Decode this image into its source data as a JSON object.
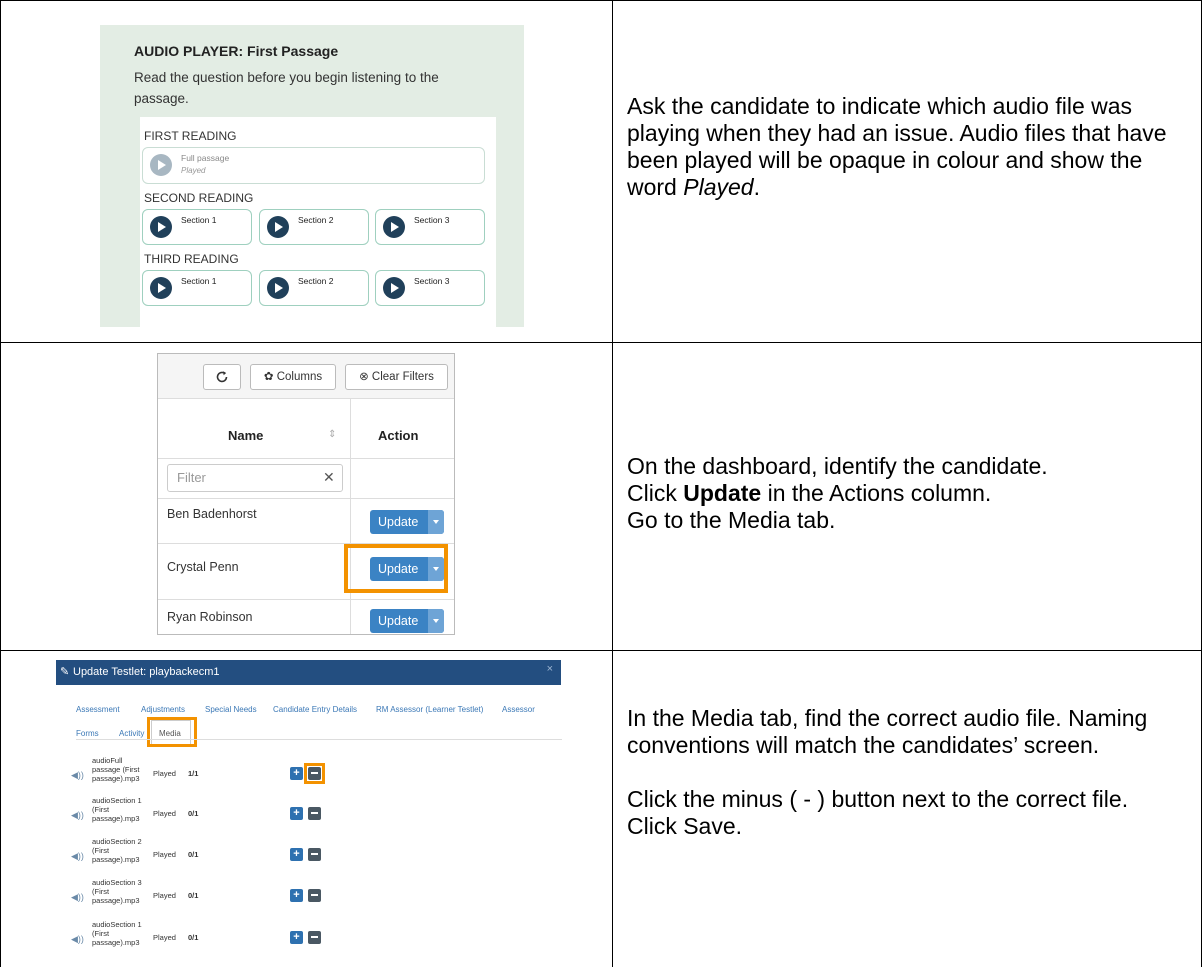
{
  "audio_player": {
    "title": "AUDIO PLAYER: First Passage",
    "subtitle": "Read the question before you begin listening to the passage.",
    "first_reading": {
      "label": "FIRST READING",
      "button_label": "Full passage",
      "button_status": "Played"
    },
    "second_reading": {
      "label": "SECOND READING",
      "buttons": [
        "Section 1",
        "Section 2",
        "Section 3"
      ]
    },
    "third_reading": {
      "label": "THIRD READING",
      "buttons": [
        "Section 1",
        "Section 2",
        "Section 3"
      ]
    }
  },
  "dashboard": {
    "toolbar": {
      "refresh_icon": "refresh-icon",
      "columns_label": "Columns",
      "clear_filters_label": "Clear Filters"
    },
    "columns": {
      "name": "Name",
      "action": "Action"
    },
    "filter_placeholder": "Filter",
    "rows": [
      {
        "name": "Ben Badenhorst",
        "action": "Update"
      },
      {
        "name": "Crystal Penn",
        "action": "Update"
      },
      {
        "name": "Ryan Robinson",
        "action": "Update"
      }
    ],
    "highlight_color": "#f39200"
  },
  "testlet": {
    "title": "Update Testlet: playbackecm1",
    "tabs": [
      "Assessment",
      "Adjustments",
      "Special Needs",
      "Candidate Entry Details",
      "RM Assessor (Learner Testlet)",
      "Assessor",
      "Forms",
      "Activity",
      "Media"
    ],
    "active_tab": "Media",
    "media": [
      {
        "file": "audioFull passage (First passage).mp3",
        "status": "Played",
        "count": "1/1"
      },
      {
        "file": "audioSection 1 (First passage).mp3",
        "status": "Played",
        "count": "0/1"
      },
      {
        "file": "audioSection 2 (First passage).mp3",
        "status": "Played",
        "count": "0/1"
      },
      {
        "file": "audioSection 3 (First passage).mp3",
        "status": "Played",
        "count": "0/1"
      },
      {
        "file": "audioSection 1 (First passage).mp3",
        "status": "Played",
        "count": "0/1"
      }
    ]
  },
  "instructions": {
    "step1": "Ask the candidate to indicate which audio file was playing when they had an issue. Audio files that have been played will be opaque in colour and show the word",
    "step1_em": "Played",
    "step2_line1": "On the dashboard, identify the candidate.",
    "step2_line2_pre": "Click",
    "step2_line2_bold": "Update",
    "step2_line2_post": "in the Actions column.",
    "step2_line3": "Go to the Media tab.",
    "step3_p1": "In the Media tab, find the correct audio file. Naming conventions will match the candidates’ screen.",
    "step3_p2": "Click the minus ( - ) button next to the correct file.",
    "step3_p3": "Click Save."
  }
}
